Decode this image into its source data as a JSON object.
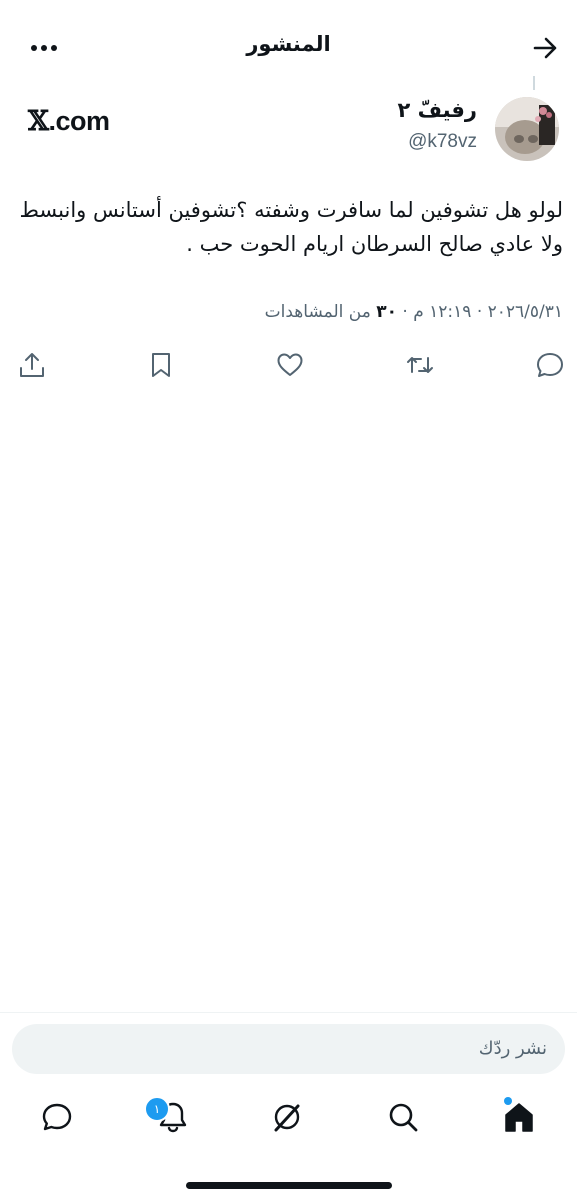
{
  "header": {
    "title": "المنشور",
    "back_icon": "arrow-icon",
    "more_icon": "more-horizontal-icon"
  },
  "author": {
    "display_name": "رفيفّ ٢",
    "handle": "@k78vz",
    "avatar_icon": "cat-photo-avatar"
  },
  "source_label": {
    "glyph": "𝕏",
    "text": ".com"
  },
  "post": {
    "text": "لولو هل تشوفين لما سافرت وشفته ؟تشوفين أستانس وانبسط ولا عادي صالح السرطان اريام الحوت حب ."
  },
  "meta": {
    "date": "٢٠٢٦/٥/٣١",
    "separator": "·",
    "time": "١٢:١٩ م",
    "views_count": "٣٠",
    "views_label": "من المشاهدات"
  },
  "actions": [
    "reply-icon",
    "retweet-icon",
    "like-icon",
    "bookmark-icon",
    "share-icon"
  ],
  "reply": {
    "placeholder": "نشر ردّك"
  },
  "tabbar": {
    "notifications_badge": "١",
    "icons": [
      "home-icon",
      "search-icon",
      "grok-icon",
      "bell-icon",
      "messages-icon"
    ]
  },
  "colors": {
    "text": "#0f1419",
    "secondary": "#536471",
    "accent": "#1d9bf0",
    "input_bg": "#eff3f4"
  }
}
